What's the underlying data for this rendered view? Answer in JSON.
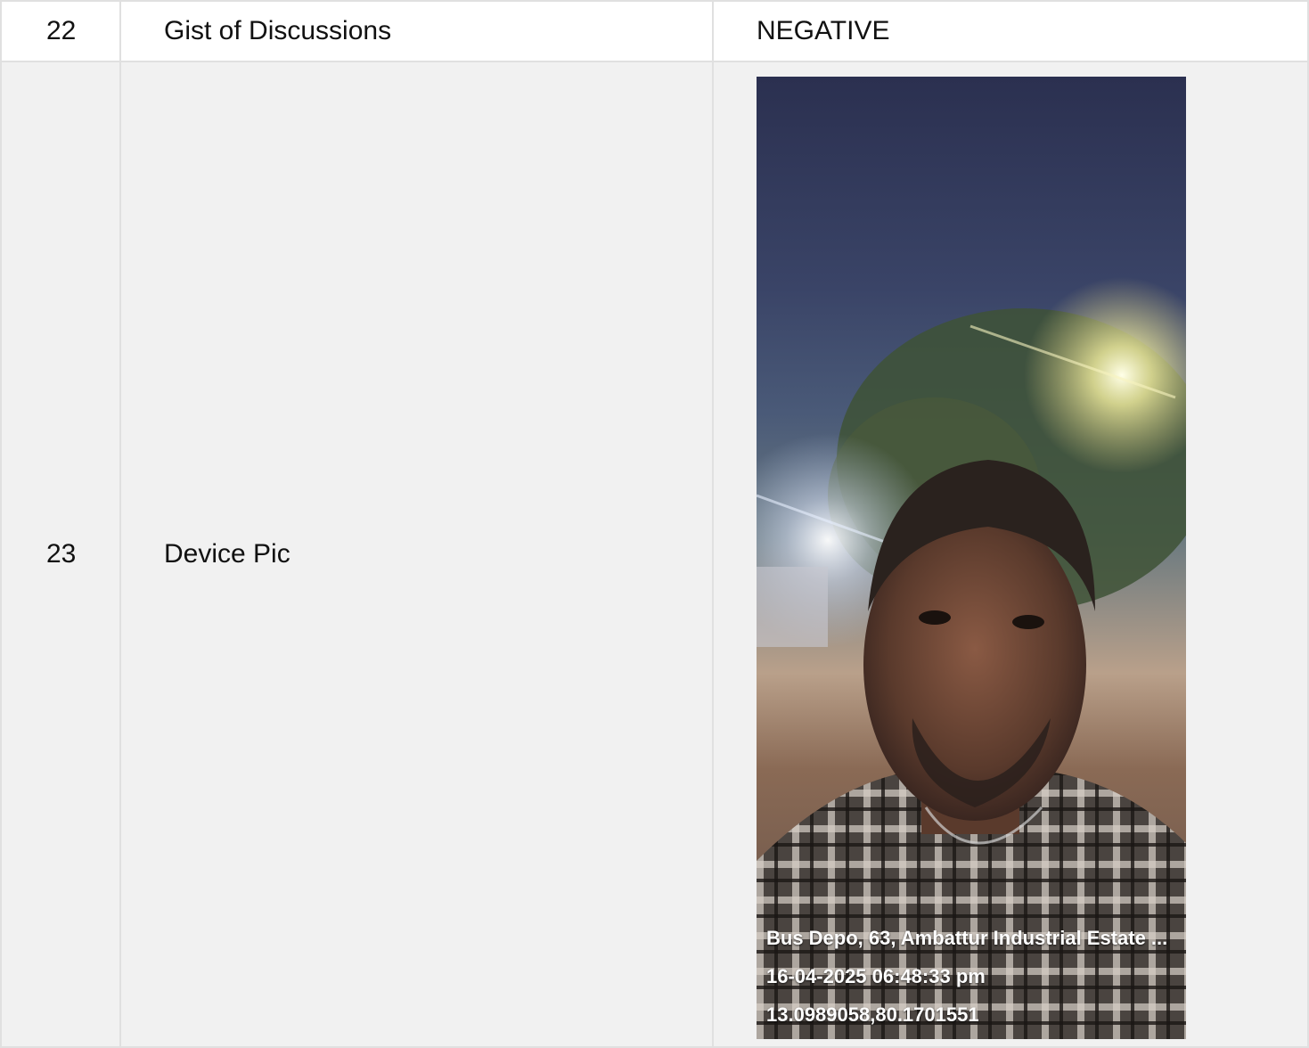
{
  "rows": [
    {
      "num": "22",
      "label": "Gist of Discussions",
      "value": "NEGATIVE"
    },
    {
      "num": "23",
      "label": "Device Pic"
    }
  ],
  "photo": {
    "overlay_lines": [
      "Bus Depo, 63, Ambattur Industrial Estate ...",
      "16-04-2025 06:48:33 pm",
      "13.0989058,80.1701551"
    ]
  }
}
